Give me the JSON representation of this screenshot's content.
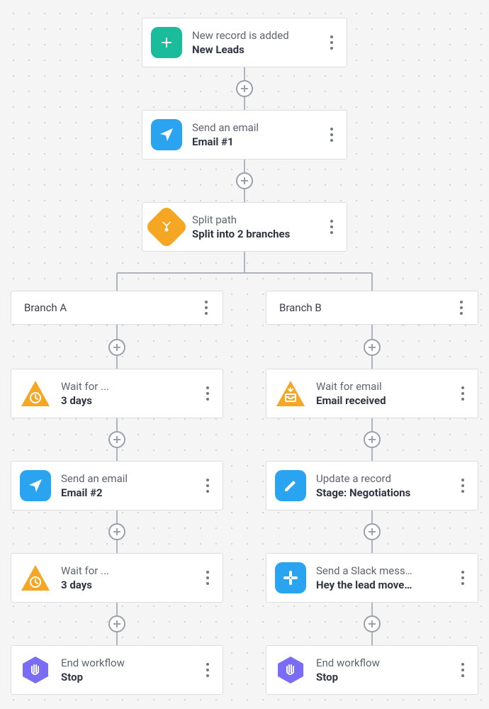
{
  "nodes": {
    "trigger": {
      "title": "New record is added",
      "subtitle": "New Leads"
    },
    "email1": {
      "title": "Send an email",
      "subtitle": "Email #1"
    },
    "split": {
      "title": "Split path",
      "subtitle": "Split into 2 branches"
    },
    "branchA": {
      "label": "Branch A"
    },
    "branchB": {
      "label": "Branch B"
    },
    "a_wait1": {
      "title": "Wait for ...",
      "subtitle": "3 days"
    },
    "a_email2": {
      "title": "Send an email",
      "subtitle": "Email #2"
    },
    "a_wait2": {
      "title": "Wait for ...",
      "subtitle": "3 days"
    },
    "a_end": {
      "title": "End workflow",
      "subtitle": "Stop"
    },
    "b_waitmail": {
      "title": "Wait for email",
      "subtitle": "Email received"
    },
    "b_update": {
      "title": "Update a record",
      "subtitle": "Stage: Negotiations"
    },
    "b_slack": {
      "title": "Send a Slack mess…",
      "subtitle": "Hey the lead move…"
    },
    "b_end": {
      "title": "End workflow",
      "subtitle": "Stop"
    }
  }
}
